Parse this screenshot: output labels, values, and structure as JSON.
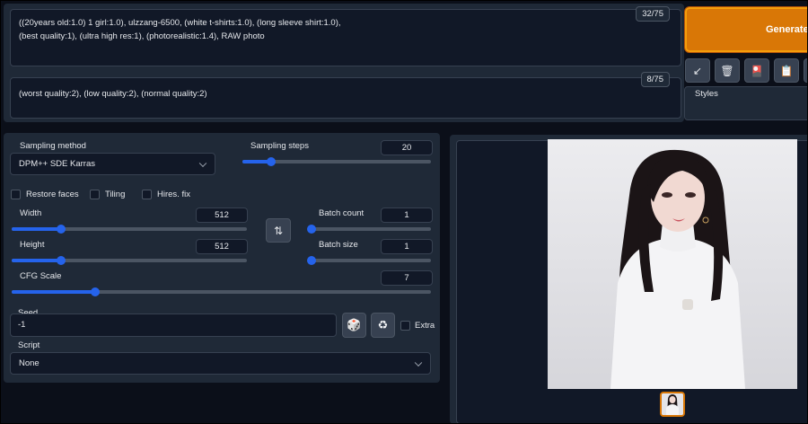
{
  "prompt": {
    "positive": "((20years old:1.0) 1 girl:1.0), ulzzang-6500, (white t-shirts:1.0), (long sleeve shirt:1.0),\n(best quality:1), (ultra high res:1), (photorealistic:1.4), RAW photo",
    "positive_count": "32/75",
    "negative": "(worst quality:2), (low quality:2), (normal quality:2)",
    "negative_count": "8/75"
  },
  "actions": {
    "generate_label": "Generate",
    "tools": [
      {
        "icon": "arrow-icon",
        "glyph": "↙"
      },
      {
        "icon": "trash-icon",
        "glyph": "🗑"
      },
      {
        "icon": "card-icon",
        "glyph": "🎴"
      },
      {
        "icon": "clipboard-icon",
        "glyph": "📋"
      },
      {
        "icon": "save-icon",
        "glyph": "💾"
      }
    ],
    "styles_label": "Styles"
  },
  "settings": {
    "sampling_method_label": "Sampling method",
    "sampling_method_value": "DPM++ SDE Karras",
    "sampling_steps_label": "Sampling steps",
    "sampling_steps_value": "20",
    "sampling_steps_level": 0.15,
    "restore_faces_label": "Restore faces",
    "tiling_label": "Tiling",
    "hires_fix_label": "Hires. fix",
    "width_label": "Width",
    "width_value": "512",
    "width_level": 0.21,
    "height_label": "Height",
    "height_value": "512",
    "height_level": 0.21,
    "batch_count_label": "Batch count",
    "batch_count_value": "1",
    "batch_size_label": "Batch size",
    "batch_size_value": "1",
    "cfg_scale_label": "CFG Scale",
    "cfg_scale_value": "7",
    "cfg_scale_level": 0.2,
    "seed_label": "Seed",
    "seed_value": "-1",
    "dice_glyph": "🎲",
    "recycle_glyph": "♻",
    "extra_label": "Extra",
    "script_label": "Script",
    "script_value": "None",
    "swap_glyph": "⇅"
  },
  "colors": {
    "accent": "#2563eb",
    "generate": "#d97706",
    "panel": "#1f2937",
    "background": "#0b0f19"
  }
}
